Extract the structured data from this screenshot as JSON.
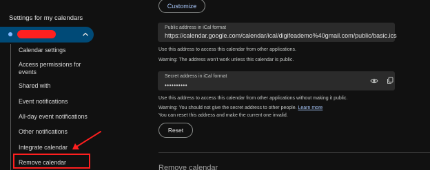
{
  "sidebar": {
    "heading": "Settings for my calendars",
    "calendar_dot_color": "#7fb8ff",
    "items": [
      {
        "label": "Calendar settings"
      },
      {
        "label": "Access permissions for events"
      },
      {
        "label": "Shared with"
      },
      {
        "label": "Event notifications"
      },
      {
        "label": "All-day event notifications"
      },
      {
        "label": "Other notifications"
      },
      {
        "label": "Integrate calendar"
      },
      {
        "label": "Remove calendar"
      }
    ],
    "highlight_color": "#ff1f1f"
  },
  "main": {
    "customize_label": "Customize",
    "public_address": {
      "label": "Public address in iCal format",
      "value": "https://calendar.google.com/calendar/ical/digifeademo%40gmail.com/public/basic.ics"
    },
    "public_help": "Use this address to access this calendar from other applications.",
    "public_warning": "Warning: The address won't work unless this calendar is public.",
    "secret_address": {
      "label": "Secret address in iCal format",
      "value": "••••••••••"
    },
    "secret_help": "Use this address to access this calendar from other applications without making it public.",
    "secret_warning": "Warning: You should not give the secret address to other people.",
    "learn_more": "Learn more",
    "reset_help": "You can reset this address and make the current one invalid.",
    "reset_label": "Reset",
    "next_section_title": "Remove calendar"
  },
  "icons": {
    "eye": "eye-icon",
    "copy": "copy-icon",
    "chevron": "chevron-up-icon",
    "arrow": "annotation-arrow"
  }
}
